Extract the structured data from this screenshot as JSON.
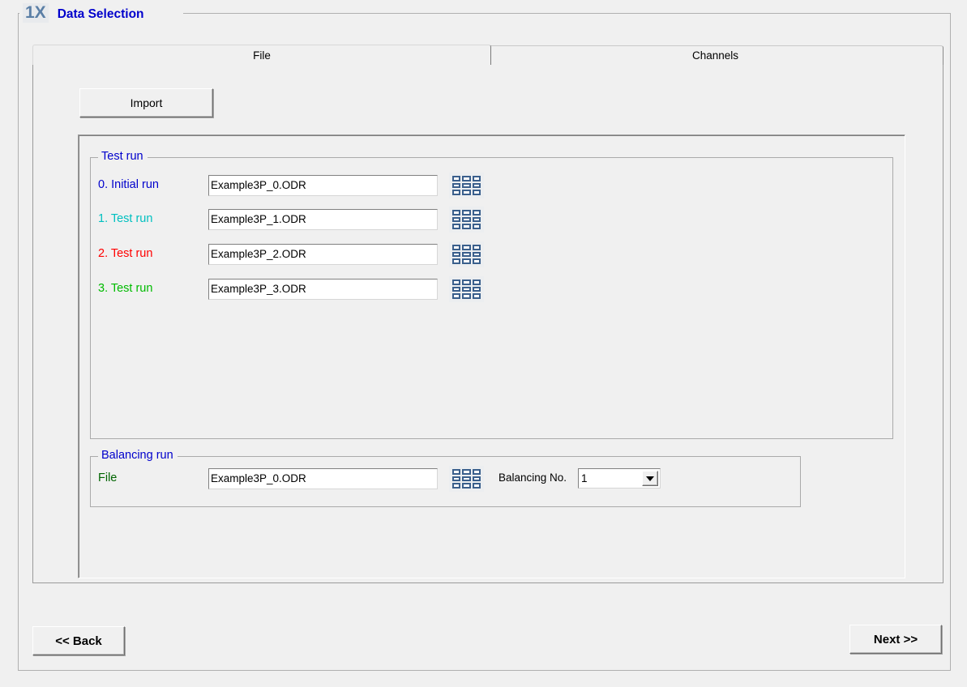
{
  "window": {
    "step_badge": "1X",
    "frame_title": "Data Selection"
  },
  "tabs": [
    {
      "id": "file",
      "label": "File",
      "active": true
    },
    {
      "id": "channels",
      "label": "Channels",
      "active": false
    }
  ],
  "toolbar": {
    "import_label": "Import"
  },
  "test_run_group": {
    "legend": "Test run",
    "legend_color": "#0000cc",
    "browse_icon": "grid-icon",
    "rows": [
      {
        "label": "0.  Initial run",
        "color": "#0000cc",
        "value": "Example3P_0.ODR"
      },
      {
        "label": "1. Test run",
        "color": "#00c0c0",
        "value": "Example3P_1.ODR"
      },
      {
        "label": "2. Test run",
        "color": "#ff0000",
        "value": "Example3P_2.ODR"
      },
      {
        "label": "3. Test run",
        "color": "#00bb00",
        "value": "Example3P_3.ODR"
      }
    ]
  },
  "balancing_group": {
    "legend": "Balancing run",
    "legend_color": "#0000cc",
    "file_label": "File",
    "file_label_color": "#006400",
    "file_value": "Example3P_0.ODR",
    "browse_icon": "grid-icon",
    "balancing_no_label": "Balancing No.",
    "balancing_no_value": "1",
    "balancing_no_options": [
      "1"
    ]
  },
  "navigation": {
    "back_label": "<< Back",
    "next_label": "Next >>"
  }
}
